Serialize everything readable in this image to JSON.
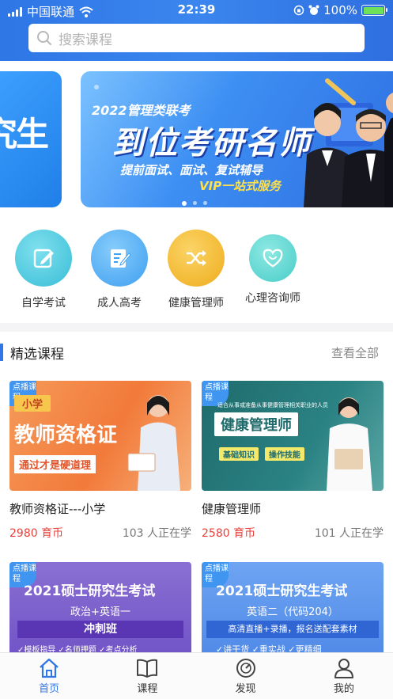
{
  "status_bar": {
    "carrier": "中国联通",
    "time": "22:39",
    "battery_percent": "100%",
    "battery_level": 1.0
  },
  "search": {
    "placeholder": "搜索课程"
  },
  "banner": {
    "left_partial_text": "究生",
    "title": "2022管理类联考",
    "headline": "到位考研名师",
    "subline": "提前面试、面试、复试辅导",
    "vip_line": "VIP一站式服务",
    "active_dot": 0,
    "dot_count": 3
  },
  "categories": [
    {
      "label": "自学考试",
      "icon": "edit-note-icon",
      "color": "#3fc1d9"
    },
    {
      "label": "成人高考",
      "icon": "document-edit-icon",
      "color": "#45a7f0"
    },
    {
      "label": "健康管理师",
      "icon": "shuffle-icon",
      "color": "#f1b525"
    },
    {
      "label": "心理咨询师",
      "icon": "heart-care-icon",
      "color": "#4fd0cc"
    }
  ],
  "section": {
    "title": "精选课程",
    "more": "查看全部"
  },
  "courses": [
    {
      "badge": "点播课程",
      "thumb_tag": "小学",
      "thumb_title": "教师资格证",
      "thumb_sub": "通过才是硬道理",
      "title": "教师资格证---小学",
      "price": "2980 育币",
      "learners": "103 人正在学"
    },
    {
      "badge": "点播课程",
      "thumb_caption": "适合从事或准备从事健康管理相关职业的人员",
      "thumb_title": "健康管理师",
      "thumb_chip_1": "基础知识",
      "thumb_chip_2": "操作技能",
      "title": "健康管理师",
      "price": "2580 育币",
      "learners": "101 人正在学"
    },
    {
      "badge": "点播课程",
      "thumb_title": "2021硕士研究生考试",
      "thumb_sub": "政治+英语一",
      "thumb_banner": "冲刺班",
      "thumb_row": "✓模板指导  ✓名师押题  ✓考点分析"
    },
    {
      "badge": "点播课程",
      "thumb_title": "2021硕士研究生考试",
      "thumb_sub": "英语二（代码204）",
      "thumb_banner": "高清直播+录播，报名送配套素材",
      "thumb_row": "✓讲干货  ✓重实战  ✓更精细"
    }
  ],
  "tabbar": [
    {
      "label": "首页",
      "icon": "home-icon",
      "active": true
    },
    {
      "label": "课程",
      "icon": "book-icon",
      "active": false
    },
    {
      "label": "发现",
      "icon": "compass-icon",
      "active": false
    },
    {
      "label": "我的",
      "icon": "user-icon",
      "active": false
    }
  ]
}
